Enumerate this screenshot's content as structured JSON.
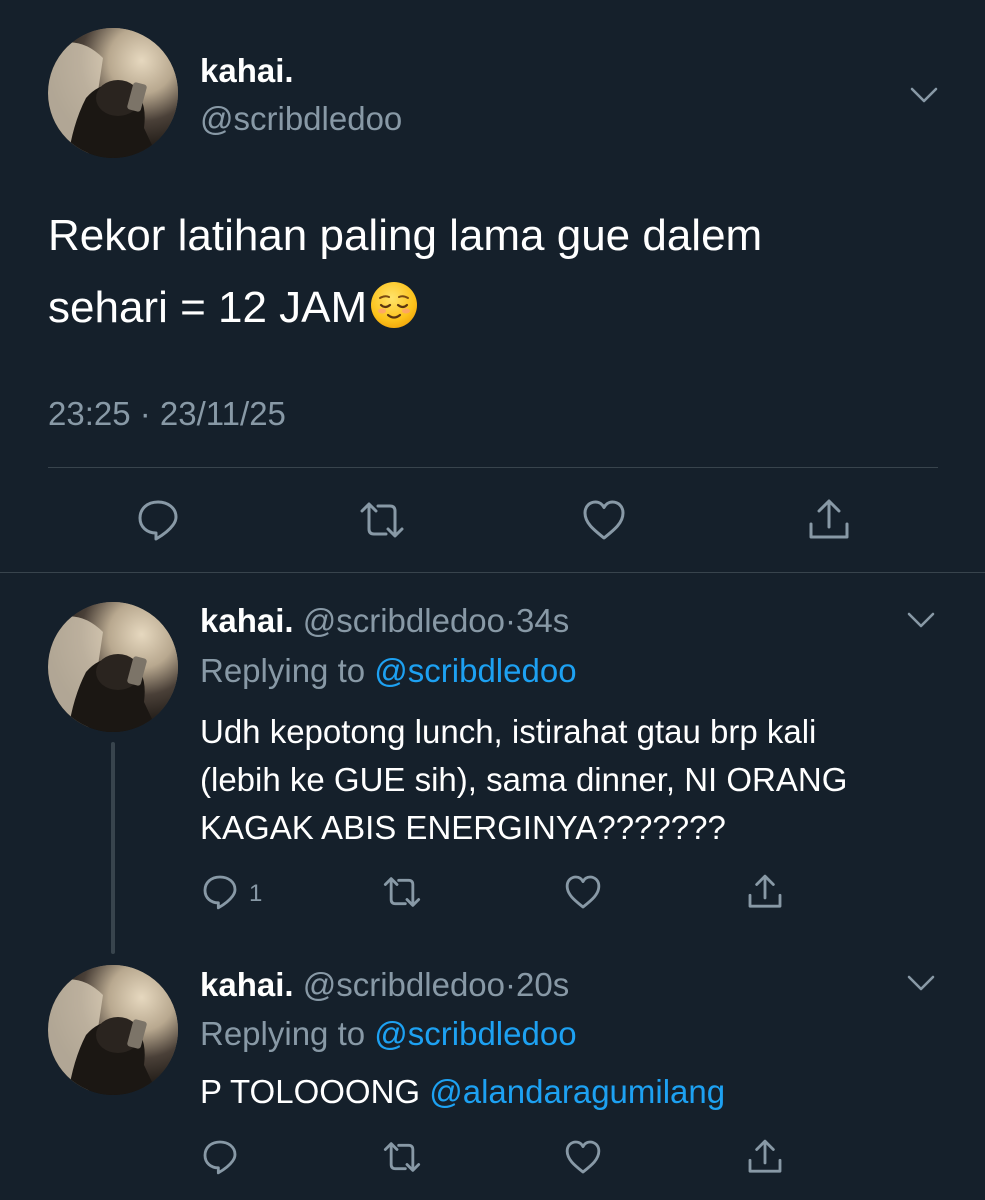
{
  "main_tweet": {
    "name": "kahai.",
    "handle": "@scribdledoo",
    "text_line1": "Rekor latihan paling lama gue dalem",
    "text_line2": "sehari = 12 JAM",
    "emoji": "relieved-face",
    "timestamp": "23:25 · 23/11/25",
    "actions": [
      "reply-icon",
      "retweet-icon",
      "like-icon",
      "share-icon"
    ]
  },
  "replies": [
    {
      "name": "kahai.",
      "handle": "@scribdledoo",
      "separator": "·",
      "time": "34s",
      "replying_label": "Replying to",
      "replying_to": "@scribdledoo",
      "text_lines": [
        "Udh kepotong lunch, istirahat gtau brp kali",
        "(lebih ke GUE sih), sama dinner, NI ORANG",
        "KAGAK ABIS ENERGINYA???????"
      ],
      "reply_count": "1"
    },
    {
      "name": "kahai.",
      "handle": "@scribdledoo",
      "separator": "·",
      "time": "20s",
      "replying_label": "Replying to",
      "replying_to": "@scribdledoo",
      "text_prefix": "P TOLOOONG",
      "text_mention": "@alandaragumilang"
    }
  ],
  "colors": {
    "background": "#15202b",
    "secondary_text": "#8899a6",
    "accent": "#1da1f2",
    "divider": "#38444d"
  }
}
